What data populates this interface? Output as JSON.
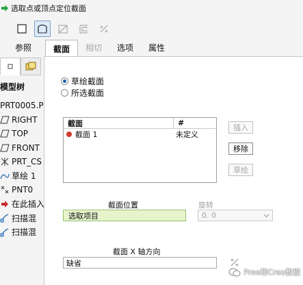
{
  "prompt": {
    "text": "选取点或顶点定位截面"
  },
  "tabs": [
    {
      "label": "参照"
    },
    {
      "label": "截面"
    },
    {
      "label": "相切"
    },
    {
      "label": "选项"
    },
    {
      "label": "属性"
    }
  ],
  "tree": {
    "title": "模型树",
    "items": [
      {
        "label": "PRT0005.P"
      },
      {
        "label": "RIGHT"
      },
      {
        "label": "TOP"
      },
      {
        "label": "FRONT"
      },
      {
        "label": "PRT_CS"
      },
      {
        "label": "草绘 1"
      },
      {
        "label": "PNT0"
      },
      {
        "label": "在此插入"
      },
      {
        "label": "扫描混"
      },
      {
        "label": "扫描混"
      }
    ]
  },
  "section": {
    "radio_sketch": "草绘截面",
    "radio_selected": "所选截面",
    "table": {
      "col_name": "截面",
      "col_hash": "#",
      "rows": [
        {
          "name": "截面 1",
          "status": "未定义"
        }
      ]
    },
    "btn_insert": "插入",
    "btn_remove": "移除",
    "btn_sketch": "草绘",
    "position_label": "截面位置",
    "position_value": "选取项目",
    "rotation_label": "旋转",
    "rotation_value": "0. 0",
    "xaxis_label": "截面 X 轴方向",
    "xaxis_value": "缺省"
  },
  "watermark": "Proe和Creo教程",
  "colors": {
    "accent": "#1b5fae",
    "green_field": "#e6f4cc",
    "status_red": "#d23a2b"
  }
}
